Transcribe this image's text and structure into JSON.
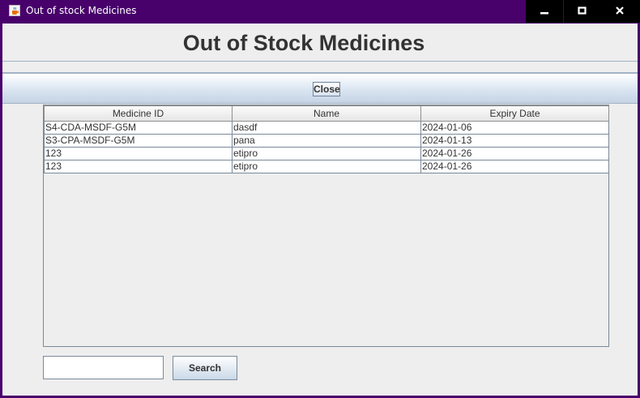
{
  "window": {
    "title": "Out of stock Medicines",
    "icon": "java-cup-icon",
    "controls": [
      "minimize-icon",
      "maximize-icon",
      "close-icon"
    ],
    "title_bar_color": "#48006b"
  },
  "header": {
    "title": "Out of Stock Medicines"
  },
  "toolbar": {
    "close_label": "Close"
  },
  "table": {
    "columns": [
      "Medicine ID",
      "Name",
      "Expiry Date"
    ],
    "rows": [
      [
        "S4-CDA-MSDF-G5M",
        "dasdf",
        "2024-01-06"
      ],
      [
        "S3-CPA-MSDF-G5M",
        "pana",
        "2024-01-13"
      ],
      [
        "123",
        "etipro",
        "2024-01-26"
      ],
      [
        "123",
        "etipro",
        "2024-01-26"
      ]
    ]
  },
  "search": {
    "value": "",
    "button_label": "Search"
  }
}
